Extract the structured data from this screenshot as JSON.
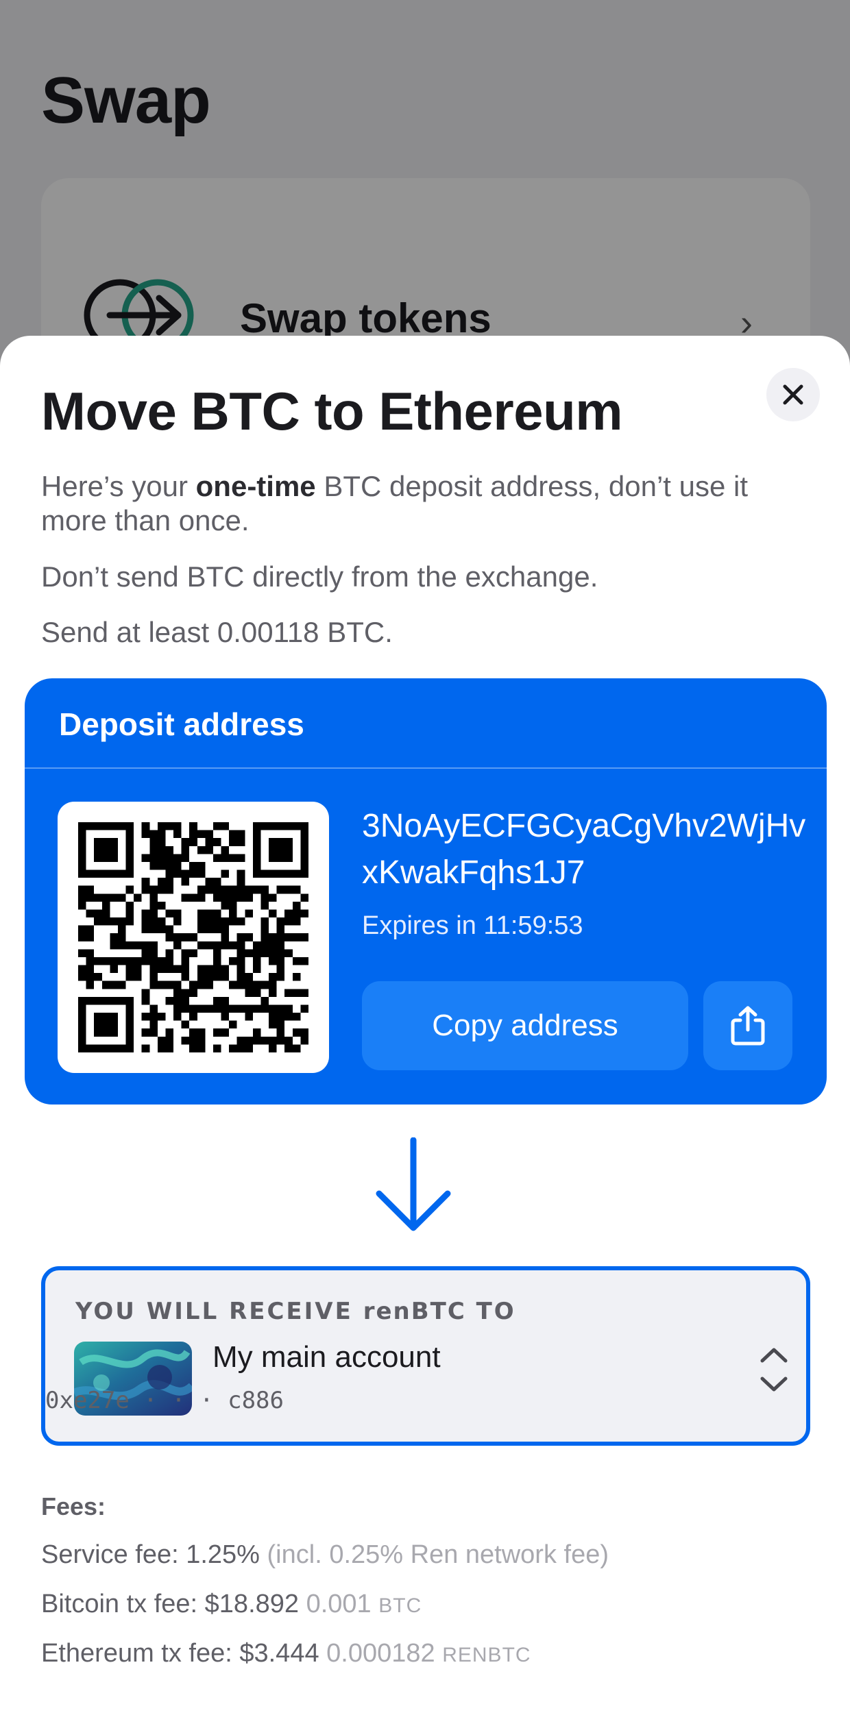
{
  "background": {
    "page_title": "Swap",
    "card_label": "Swap tokens"
  },
  "sheet": {
    "title": "Move BTC to Ethereum",
    "intro_prefix": "Here’s your ",
    "intro_bold": "one-time",
    "intro_suffix": " BTC deposit address, don’t use it more than once.",
    "warning": "Don’t send BTC directly from the exchange.",
    "minimum": "Send at least 0.00118 BTC."
  },
  "deposit": {
    "title": "Deposit address",
    "address": "3NoAyECFGCyaCgVhv2WjHvxKwakFqhs1J7",
    "expires": "Expires in 11:59:53",
    "copy_label": "Copy address"
  },
  "receive": {
    "heading_prefix": "YOU WILL RECEIVE ",
    "heading_token": "renBTC",
    "heading_suffix": " TO",
    "account_name": "My main account",
    "account_address": "0xe27e · · · c886"
  },
  "fees": {
    "title": "Fees:",
    "service_label": "Service fee: 1.25%",
    "service_note": "(incl. 0.25% Ren network fee)",
    "bitcoin_label": "Bitcoin tx fee: $18.892",
    "bitcoin_amount": "0.001",
    "bitcoin_unit": "BTC",
    "ethereum_label": "Ethereum tx fee: $3.444",
    "ethereum_amount": "0.000182",
    "ethereum_unit": "RENBTC"
  },
  "colors": {
    "accent": "#0067ee",
    "accent_light": "#1a7ff7",
    "text_primary": "#1b1b1f",
    "text_secondary": "#5f5f66",
    "text_muted": "#a8a8ae"
  },
  "icons": {
    "close": "close-icon",
    "share": "share-icon",
    "arrow": "arrow-down-icon",
    "selector": "chevron-up-down-icon",
    "swap": "swap-arrow-icon",
    "chevron": "chevron-right-icon"
  }
}
